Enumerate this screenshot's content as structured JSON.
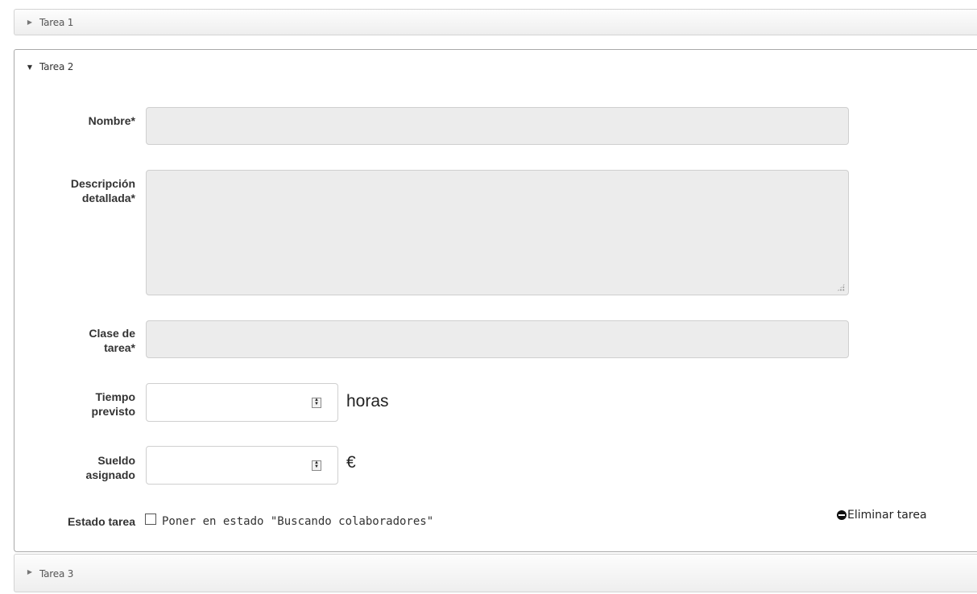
{
  "accordion": {
    "tasks": [
      {
        "title": "Tarea 1",
        "expanded": false
      },
      {
        "title": "Tarea 2",
        "expanded": true
      },
      {
        "title": "Tarea 3",
        "expanded": false
      }
    ]
  },
  "icons": {
    "collapsed": "triangle-right-icon",
    "expanded": "triangle-down-icon",
    "delete": "minus-circle-icon",
    "spinner": "spinner-arrows-icon"
  },
  "form": {
    "nombre": {
      "label": "Nombre*",
      "value": ""
    },
    "descripcion": {
      "label": "Descripción detallada*",
      "value": ""
    },
    "clase": {
      "label": "Clase de tarea*",
      "value": ""
    },
    "tiempo": {
      "label": "Tiempo previsto",
      "value": "",
      "unit": "horas"
    },
    "sueldo": {
      "label": "Sueldo asignado",
      "value": "",
      "unit": "€"
    },
    "estado": {
      "label": "Estado tarea",
      "checkbox_label": "Poner en estado \"Buscando colaboradores\"",
      "checked": false
    },
    "delete_label": "Eliminar tarea"
  }
}
